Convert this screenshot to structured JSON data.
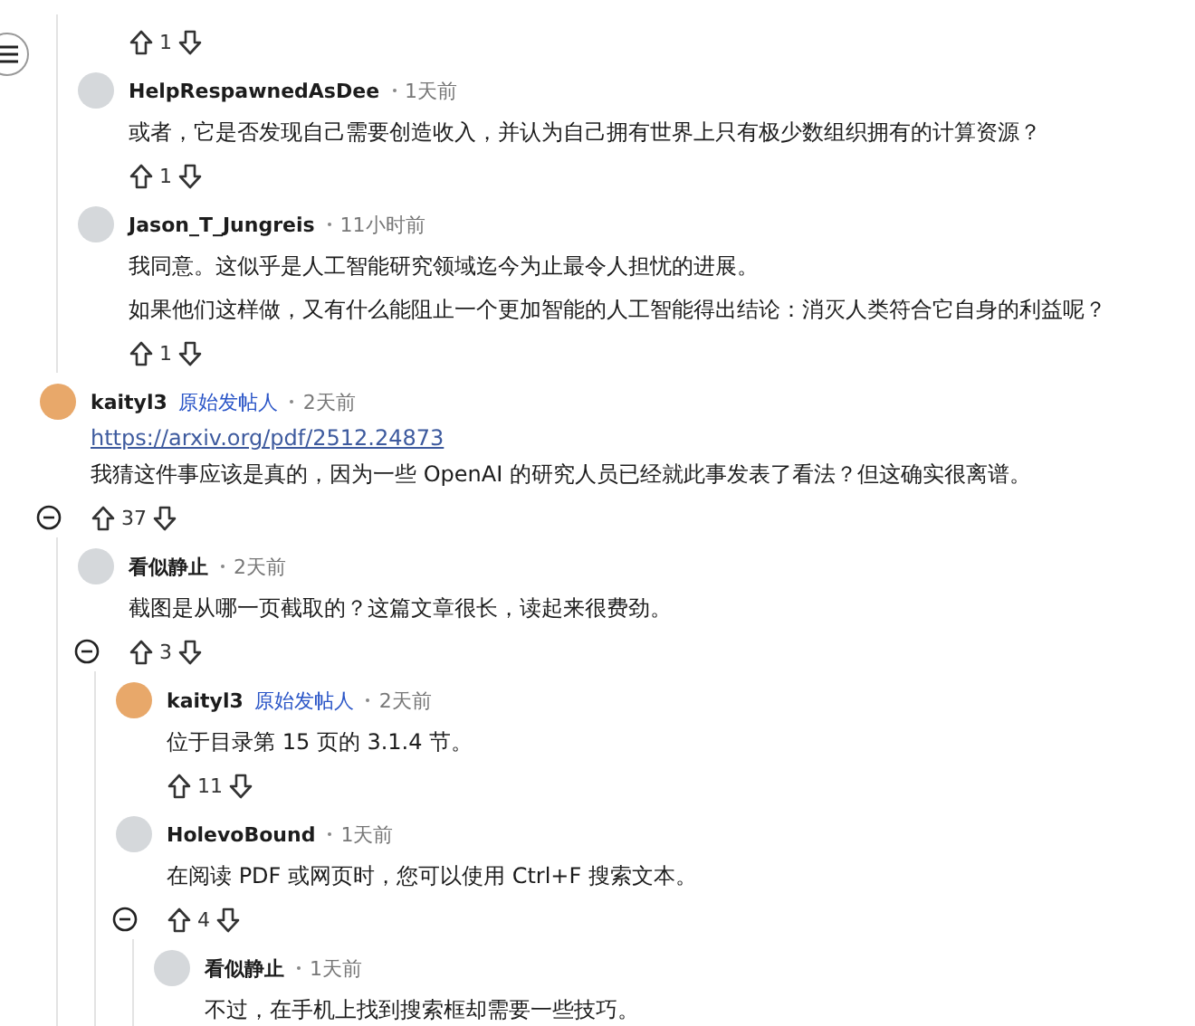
{
  "replies_above": [
    {
      "votes": "1"
    },
    {
      "author": "HelpRespawnedAsDee",
      "color": "#d5d8db",
      "time": "1天前",
      "body": [
        "或者，它是否发现自己需要创造收入，并认为自己拥有世界上只有极少数组织拥有的计算资源？"
      ],
      "votes": "1"
    },
    {
      "author": "Jason_T_Jungreis",
      "color": "#d5d8db",
      "time": "11小时前",
      "body": [
        "我同意。这似乎是人工智能研究领域迄今为止最令人担忧的进展。",
        "如果他们这样做，又有什么能阻止一个更加智能的人工智能得出结论：消灭人类符合它自身的利益呢？"
      ],
      "votes": "1"
    }
  ],
  "comments": [
    {
      "author": "kaityl3",
      "op_badge": "原始发帖人",
      "color": "#e8a86a",
      "time": "2天前",
      "link": "https://arxiv.org/pdf/2512.24873",
      "body": [
        "我猜这件事应该是真的，因为一些 OpenAI 的研究人员已经就此事发表了看法？但这确实很离谱。"
      ],
      "votes": "37",
      "expanded": true,
      "children": [
        {
          "author": "看似静止",
          "color": "#d5d8db",
          "time": "2天前",
          "body": [
            "截图是从哪一页截取的？这篇文章很长，读起来很费劲。"
          ],
          "votes": "3",
          "expanded": true,
          "children": [
            {
              "author": "kaityl3",
              "op_badge": "原始发帖人",
              "color": "#e8a86a",
              "time": "2天前",
              "body": [
                "位于目录第 15 页的 3.1.4 节。"
              ],
              "votes": "11"
            },
            {
              "author": "HolevoBound",
              "color": "#d5d8db",
              "time": "1天前",
              "body": [
                "在阅读 PDF 或网页时，您可以使用 Ctrl+F 搜索文本。"
              ],
              "votes": "4",
              "expanded": true,
              "children": [
                {
                  "author": "看似静止",
                  "color": "#d5d8db",
                  "time": "1天前",
                  "body": [
                    "不过，在手机上找到搜索框却需要一些技巧。"
                  ]
                }
              ]
            }
          ]
        }
      ]
    }
  ]
}
